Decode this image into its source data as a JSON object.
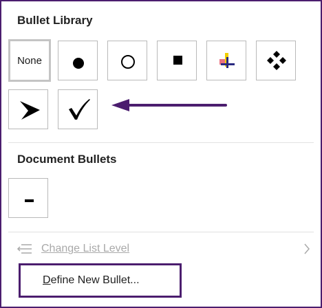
{
  "bullet_library": {
    "title": "Bullet Library",
    "items": [
      {
        "label": "None",
        "icon": "none-text",
        "selected": true
      },
      {
        "icon": "filled-circle-icon"
      },
      {
        "icon": "hollow-circle-icon"
      },
      {
        "icon": "filled-square-icon"
      },
      {
        "icon": "colorful-cross-icon"
      },
      {
        "icon": "diamond-dots-icon"
      },
      {
        "icon": "arrowhead-icon"
      },
      {
        "icon": "checkmark-icon"
      }
    ]
  },
  "document_bullets": {
    "title": "Document Bullets",
    "items": [
      {
        "icon": "dash-icon"
      }
    ]
  },
  "menu": {
    "change_list_level": "Change List Level",
    "define_new_bullet_prefix": "D",
    "define_new_bullet_rest": "efine New Bullet..."
  },
  "colors": {
    "annotation_purple": "#4b1d6e",
    "disabled_text": "#a9a9a9"
  }
}
